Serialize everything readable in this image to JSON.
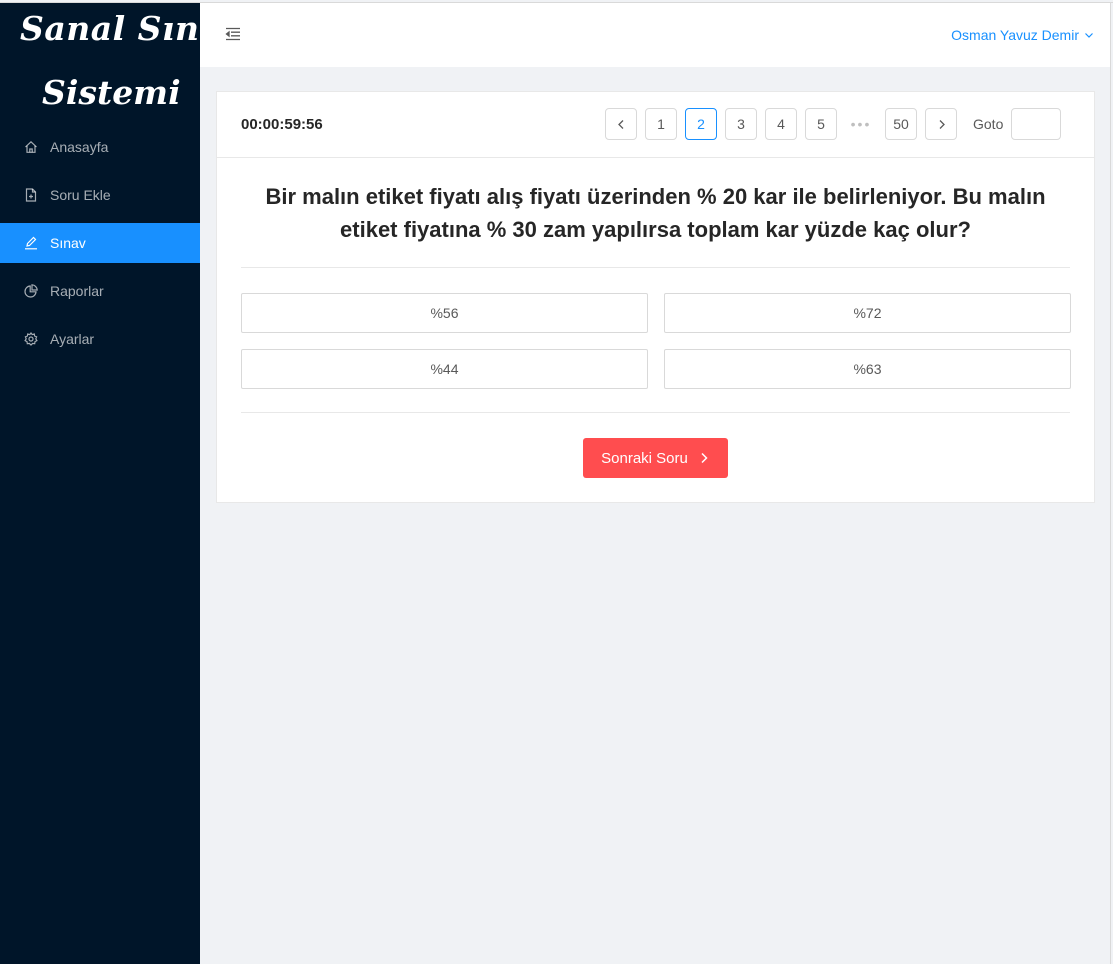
{
  "app": {
    "logo_line1": "Sanal Sınav",
    "logo_line2": "Sistemi"
  },
  "sidebar": {
    "items": [
      {
        "label": "Anasayfa",
        "icon": "home-icon"
      },
      {
        "label": "Soru Ekle",
        "icon": "file-add-icon"
      },
      {
        "label": "Sınav",
        "icon": "edit-icon",
        "active": true
      },
      {
        "label": "Raporlar",
        "icon": "pie-chart-icon"
      },
      {
        "label": "Ayarlar",
        "icon": "gear-icon"
      }
    ]
  },
  "header": {
    "user_name": "Osman Yavuz Demir"
  },
  "exam": {
    "timer": "00:00:59:56",
    "pages": [
      "1",
      "2",
      "3",
      "4",
      "5"
    ],
    "last_page": "50",
    "current_page": "2",
    "goto_label": "Goto",
    "goto_value": "",
    "question": "Bir malın etiket fiyatı alış fiyatı üzerinden % 20 kar ile belirleniyor. Bu malın etiket fiyatına % 30 zam yapılırsa toplam kar yüzde kaç olur?",
    "options": [
      "%56",
      "%72",
      "%44",
      "%63"
    ],
    "next_label": "Sonraki Soru"
  },
  "colors": {
    "sidebar_bg": "#001529",
    "accent": "#1890ff",
    "next_button": "#ff4d4f"
  }
}
